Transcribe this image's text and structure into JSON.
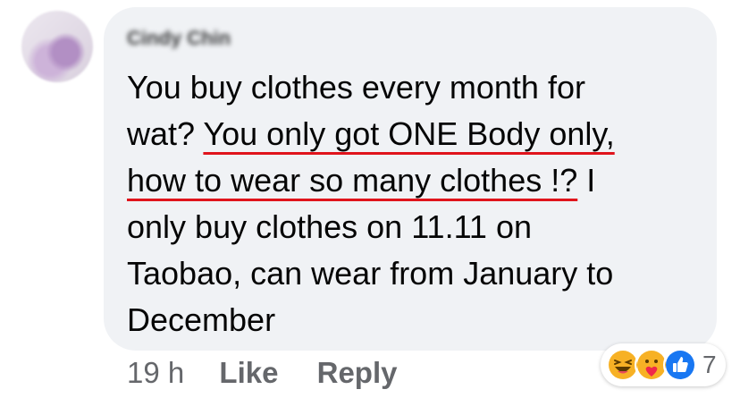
{
  "comment": {
    "author": "Cindy Chin",
    "lines": [
      "You buy clothes every month for",
      "wat? ",
      "You only got ONE Body only,",
      "how to wear so many clothes !?",
      " I",
      "only buy clothes on 11.11 on",
      "Taobao, can wear from January to",
      "December"
    ]
  },
  "actions": {
    "time": "19 h",
    "like": "Like",
    "reply": "Reply"
  },
  "reactions": {
    "icons": [
      "laughing-emoji-icon",
      "care-emoji-icon",
      "like-thumb-icon"
    ],
    "count": "7"
  },
  "colors": {
    "bubble": "#f0f2f5",
    "underline": "#e0141c",
    "like_blue": "#1877f2"
  }
}
